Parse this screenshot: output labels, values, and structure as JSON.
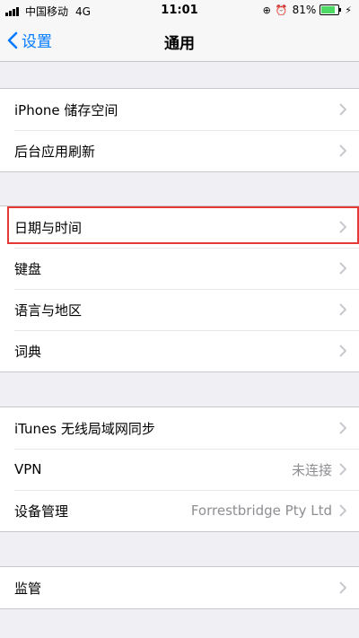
{
  "status_bar": {
    "carrier": "中国移动",
    "network": "4G",
    "time": "11:01",
    "battery_percent": "81%",
    "battery_level": 0.81
  },
  "nav": {
    "back_label": "设置",
    "title": "通用"
  },
  "groups": [
    {
      "rows": [
        {
          "label": "iPhone 储存空间",
          "value": ""
        },
        {
          "label": "后台应用刷新",
          "value": ""
        }
      ]
    },
    {
      "rows": [
        {
          "label": "日期与时间",
          "value": "",
          "highlighted": true
        },
        {
          "label": "键盘",
          "value": ""
        },
        {
          "label": "语言与地区",
          "value": ""
        },
        {
          "label": "词典",
          "value": ""
        }
      ]
    },
    {
      "rows": [
        {
          "label": "iTunes 无线局域网同步",
          "value": ""
        },
        {
          "label": "VPN",
          "value": "未连接"
        },
        {
          "label": "设备管理",
          "value": "Forrestbridge Pty Ltd"
        }
      ]
    },
    {
      "rows": [
        {
          "label": "监管",
          "value": ""
        }
      ]
    }
  ],
  "colors": {
    "accent": "#007aff",
    "highlight": "#e53935",
    "background": "#efeff4"
  },
  "icons": [
    "signal-icon",
    "rotation-lock-icon",
    "alarm-icon",
    "battery-icon",
    "charging-icon",
    "back-chevron-icon",
    "chevron-right-icon"
  ]
}
